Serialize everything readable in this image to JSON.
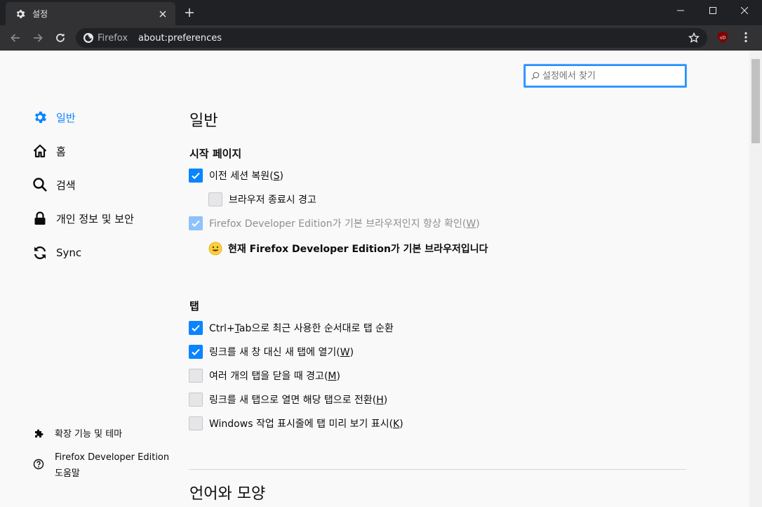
{
  "tab": {
    "title": "설정"
  },
  "navbar": {
    "identity_label": "Firefox",
    "url": "about:preferences"
  },
  "search": {
    "placeholder": "설정에서 찾기"
  },
  "sidebar": {
    "items": [
      {
        "label": "일반",
        "icon": "gear-icon",
        "active": true
      },
      {
        "label": "홈",
        "icon": "home-icon"
      },
      {
        "label": "검색",
        "icon": "search-icon"
      },
      {
        "label": "개인 정보 및 보안",
        "icon": "lock-icon"
      },
      {
        "label": "Sync",
        "icon": "sync-icon"
      }
    ],
    "footer": [
      {
        "label": "확장 기능 및 테마",
        "icon": "puzzle-icon"
      },
      {
        "label_line1": "Firefox Developer Edition",
        "label_line2": "도움말",
        "icon": "help-icon"
      }
    ]
  },
  "main": {
    "title": "일반",
    "startup": {
      "heading": "시작 페이지",
      "restore_session": {
        "text": "이전 세션 복원",
        "key": "S",
        "checked": true
      },
      "warn_on_quit": {
        "text": "브라우저 종료시 경고",
        "checked": false
      },
      "check_default": {
        "text": "Firefox Developer Edition가 기본 브라우저인지 항상 확인",
        "key": "W",
        "checked": true,
        "disabled": true
      },
      "default_message": "현재 Firefox Developer Edition가 기본 브라우저입니다"
    },
    "tabs": {
      "heading": "탭",
      "ctrl_tab": {
        "pre": "Ctrl+",
        "key": "T",
        "post": "ab으로 최근 사용한 순서대로 탭 순환",
        "checked": true
      },
      "open_links_in_tabs": {
        "text": "링크를 새 창 대신 새 탭에 열기",
        "key": "W",
        "checked": true
      },
      "warn_on_close": {
        "text": "여러 개의 탭을 닫을 때 경고",
        "key": "M",
        "checked": false
      },
      "switch_to_new_tab": {
        "text": "링크를 새 탭으로 열면 해당 탭으로 전환",
        "key": "H",
        "checked": false
      },
      "taskbar_previews": {
        "text": "Windows 작업 표시줄에 탭 미리 보기 표시",
        "key": "K",
        "checked": false
      }
    },
    "language_heading": "언어와 모양"
  },
  "colors": {
    "accent": "#0a84ff",
    "titlebar": "#202124",
    "toolbar": "#323234"
  }
}
